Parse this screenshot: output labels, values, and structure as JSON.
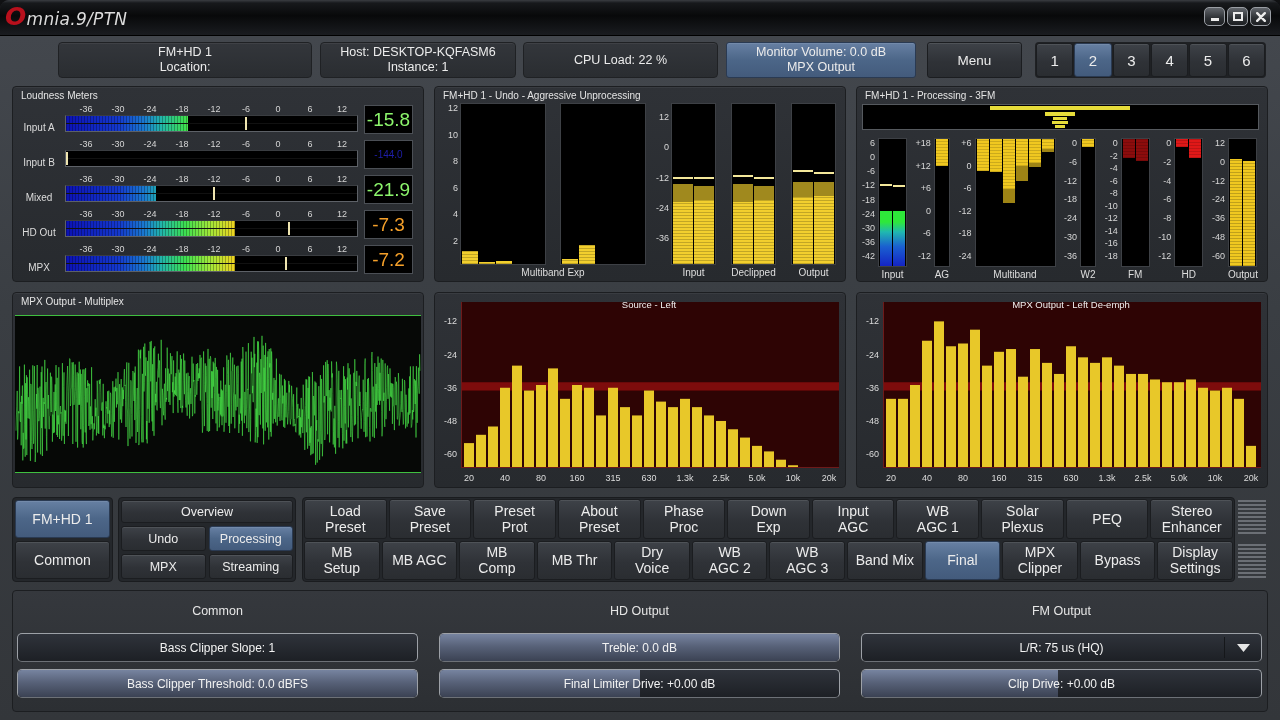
{
  "window": {
    "logo": "Omnia.9/PTN"
  },
  "header": {
    "info": [
      {
        "lines": [
          "FM+HD 1",
          "Location:"
        ]
      },
      {
        "lines": [
          "Host: DESKTOP-KQFASM6",
          "Instance: 1"
        ]
      },
      {
        "lines": [
          "CPU Load: 22 %"
        ]
      }
    ],
    "monitor": {
      "label": "Monitor Volume: 0.0 dB\nMPX Output",
      "active": true
    },
    "menu": "Menu",
    "presets": [
      {
        "label": "1",
        "selected": false
      },
      {
        "label": "2",
        "selected": true
      },
      {
        "label": "3",
        "selected": false
      },
      {
        "label": "4",
        "selected": false
      },
      {
        "label": "5",
        "selected": false
      },
      {
        "label": "6",
        "selected": false
      }
    ]
  },
  "loudness": {
    "title": "Loudness Meters",
    "meters": [
      {
        "label": "Input A",
        "kind": "input",
        "scale": [
          "-36",
          "-30",
          "-24",
          "-18",
          "-12",
          "-6",
          "0",
          "6",
          "12"
        ],
        "level": 0.42,
        "peak": {
          "level": 0.62
        },
        "reading": "-15.8",
        "dimmed": false
      },
      {
        "label": "Input B",
        "kind": "input",
        "scale": [
          "-36",
          "-30",
          "-24",
          "-18",
          "-12",
          "-6",
          "0",
          "6",
          "12"
        ],
        "level": 0,
        "peak": {
          "level": 0.005
        },
        "reading": "-144.0",
        "dimmed": true
      },
      {
        "label": "Mixed",
        "kind": "input",
        "scale": [
          "-36",
          "-30",
          "-24",
          "-18",
          "-12",
          "-6",
          "0",
          "6",
          "12"
        ],
        "level": 0.31,
        "peak": {
          "level": 0.51
        },
        "reading": "-21.9",
        "dimmed": false
      },
      {
        "label": "HD Out",
        "kind": "output",
        "scale": [
          "-36",
          "-30",
          "-24",
          "-18",
          "-12",
          "-6",
          "0",
          "6",
          "12"
        ],
        "level": 0.58,
        "peak": {
          "level": 0.765
        },
        "reading": "-7.3",
        "dimmed": false
      },
      {
        "label": "MPX",
        "kind": "output",
        "scale": [
          "-36",
          "-30",
          "-24",
          "-18",
          "-12",
          "-6",
          "0",
          "6",
          "12"
        ],
        "level": 0.58,
        "peak": {
          "level": 0.755
        },
        "reading": "-7.2",
        "dimmed": false
      }
    ]
  },
  "undo_panel": {
    "title": "FM+HD 1 - Undo - Aggressive Unprocessing",
    "multiband": {
      "label": "Multiband Exp",
      "scale": [
        "12",
        "10",
        "8",
        "6",
        "4",
        "2"
      ],
      "boxes": [
        {
          "bars": [
            {
              "level": 0.08
            },
            {
              "level": 0.01
            },
            {
              "level": 0.02
            }
          ]
        },
        {
          "bars": [
            {
              "level": 0.03
            },
            {
              "level": 0.12
            }
          ]
        }
      ]
    },
    "scale": [
      "12",
      "0",
      "-12",
      "-24",
      "-36"
    ],
    "meters": [
      {
        "label": "Input",
        "bars": [
          {
            "level": 0.39,
            "hold": {
              "level": 0.5
            },
            "peak": {
              "level": 0.54
            }
          },
          {
            "level": 0.4,
            "hold": {
              "level": 0.485
            },
            "peak": {
              "level": 0.536
            }
          }
        ]
      },
      {
        "label": "Declipped",
        "bars": [
          {
            "level": 0.39,
            "hold": {
              "level": 0.5
            },
            "peak": {
              "level": 0.55
            }
          },
          {
            "level": 0.4,
            "hold": {
              "level": 0.485
            },
            "peak": {
              "level": 0.54
            }
          }
        ]
      },
      {
        "label": "Output",
        "bars": [
          {
            "level": 0.417,
            "hold": {
              "level": 0.513
            },
            "peak": {
              "level": 0.583
            }
          },
          {
            "level": 0.423,
            "hold": {
              "level": 0.513
            },
            "peak": {
              "level": 0.567
            }
          }
        ]
      }
    ]
  },
  "processing_panel": {
    "title": "FM+HD 1 - Processing - 3FM",
    "meters": [
      {
        "label": "Input",
        "kind": "input",
        "color": "#2ee83a",
        "scale": [
          "6",
          "0",
          "-6",
          "-12",
          "-18",
          "-24",
          "-30",
          "-36",
          "-42"
        ],
        "bars": [
          {
            "level": 0.43,
            "peak": {
              "level": 0.64
            }
          },
          {
            "level": 0.43,
            "peak": {
              "level": 0.63
            }
          }
        ]
      },
      {
        "label": "AG",
        "kind": "gain",
        "color": "#f0c820",
        "scale": [
          "+18",
          "+12",
          "+6",
          "0",
          "-6",
          "-12"
        ],
        "bars": [
          {
            "level": 0.21
          }
        ]
      },
      {
        "label": "Multiband",
        "kind": "gain",
        "color": "#f0c820",
        "scale": [
          "+6",
          "0",
          "-6",
          "-12",
          "-18",
          "-24"
        ],
        "bars": [
          {
            "level": 0.25
          },
          {
            "level": 0.26
          },
          {
            "level": 0.39,
            "hold": {
              "level": 0.5
            }
          },
          {
            "level": 0.21,
            "hold": {
              "level": 0.33
            }
          },
          {
            "level": 0.19,
            "hold": {
              "level": 0.22
            }
          },
          {
            "level": 0.08,
            "hold": {
              "level": 0.1
            }
          }
        ]
      },
      {
        "label": "W2",
        "kind": "gain",
        "color": "#f0c820",
        "scale": [
          "0",
          "-6",
          "-12",
          "-18",
          "-24",
          "-30",
          "-36"
        ],
        "bars": [
          {
            "level": 0.06
          }
        ]
      },
      {
        "label": "FM",
        "kind": "gain",
        "color": "#8c0c0c",
        "scale": [
          "0",
          "-2",
          "-4",
          "-6",
          "-8",
          "-10",
          "-12",
          "-14",
          "-16",
          "-18"
        ],
        "bars": [
          {
            "level": 0.15
          },
          {
            "level": 0.17
          }
        ]
      },
      {
        "label": "HD",
        "kind": "gain",
        "color": "#e01818",
        "scale": [
          "0",
          "-2",
          "-4",
          "-6",
          "-8",
          "-10",
          "-12"
        ],
        "bars": [
          {
            "level": 0.065
          },
          {
            "level": 0.15
          }
        ]
      },
      {
        "label": "Output",
        "kind": "level",
        "color": "#f0c820",
        "scale": [
          "12",
          "0",
          "-12",
          "-24",
          "-36",
          "-48",
          "-60"
        ],
        "bars": [
          {
            "level": 0.84
          },
          {
            "level": 0.83
          }
        ]
      }
    ]
  },
  "scope": {
    "title": "MPX Output - Multiplex"
  },
  "spectra": [
    {
      "chart_data": {
        "type": "bar",
        "title": "Source - Left",
        "categories": [
          "20",
          null,
          null,
          "40",
          null,
          null,
          "80",
          null,
          null,
          "160",
          null,
          null,
          "315",
          null,
          null,
          "630",
          null,
          null,
          "1.3k",
          null,
          null,
          "2.5k",
          null,
          null,
          "5.0k",
          null,
          null,
          "10k",
          null,
          null,
          "20k"
        ],
        "values": [
          9,
          12,
          15,
          29,
          37,
          28,
          30,
          36,
          25,
          30,
          29,
          19,
          29,
          22,
          19,
          28,
          24,
          22,
          25,
          22,
          19,
          17,
          14,
          11,
          8,
          6,
          3,
          1,
          null,
          null,
          null
        ],
        "base": [
          -65,
          -65,
          -65,
          -65,
          -65,
          -65,
          -65,
          -65,
          -65,
          -65,
          -65,
          -65,
          -65,
          -65,
          -65,
          -65,
          -65,
          -65,
          -65,
          -65,
          -65,
          -65,
          -65,
          -65,
          -65,
          -65,
          -65,
          -65,
          null,
          null,
          null
        ],
        "color": "#e8c829",
        "ylim": [
          -65,
          -5
        ],
        "yticks": [
          -12,
          -24,
          -36,
          -48,
          -60
        ],
        "bands": [
          {
            "axis": "y",
            "from": -37,
            "to": -34,
            "color": "#7e0c0c"
          }
        ]
      }
    },
    {
      "chart_data": {
        "type": "bar",
        "title": "MPX Output - Left De-emph",
        "categories": [
          "20",
          null,
          null,
          "40",
          null,
          null,
          "80",
          null,
          null,
          "160",
          null,
          null,
          "315",
          null,
          null,
          "630",
          null,
          null,
          "1.3k",
          null,
          null,
          "2.5k",
          null,
          null,
          "5.0k",
          null,
          null,
          "10k",
          null,
          null,
          "20k"
        ],
        "values": [
          25,
          25,
          30,
          46,
          53,
          44,
          45,
          50,
          37,
          42,
          43,
          33,
          43,
          38,
          34,
          44,
          40,
          38,
          40,
          37,
          34,
          34,
          32,
          31,
          31,
          32,
          29,
          28,
          29,
          25,
          8
        ],
        "base": [
          -65,
          -65,
          -65,
          -65,
          -65,
          -65,
          -65,
          -65,
          -65,
          -65,
          -65,
          -65,
          -65,
          -65,
          -65,
          -65,
          -65,
          -65,
          -65,
          -65,
          -65,
          -65,
          -65,
          -65,
          -65,
          -65,
          -65,
          -65,
          -65,
          -65,
          -65
        ],
        "color": "#e8c829",
        "ylim": [
          -65,
          -5
        ],
        "yticks": [
          -12,
          -24,
          -36,
          -48,
          -60
        ],
        "bands": [
          {
            "axis": "y",
            "from": -37,
            "to": -34,
            "color": "#7e0c0c"
          }
        ]
      }
    }
  ],
  "nav": {
    "channels": [
      {
        "label": "FM+HD 1",
        "selected": true
      },
      {
        "label": "Common",
        "selected": false
      }
    ],
    "views": [
      {
        "label": "Overview",
        "selected": false
      },
      {
        "label": "Undo",
        "selected": false
      },
      {
        "label": "Processing",
        "selected": true
      },
      {
        "label": "MPX",
        "selected": false
      },
      {
        "label": "Streaming",
        "selected": false
      }
    ],
    "rows": [
      {
        "buttons": [
          {
            "label": "Load\nPreset",
            "selected": false
          },
          {
            "label": "Save\nPreset",
            "selected": false
          },
          {
            "label": "Preset\nProt",
            "selected": false
          },
          {
            "label": "About\nPreset",
            "selected": false
          },
          {
            "label": "Phase\nProc",
            "selected": false
          },
          {
            "label": "Down\nExp",
            "selected": false
          },
          {
            "label": "Input\nAGC",
            "selected": false
          },
          {
            "label": "WB\nAGC 1",
            "selected": false
          },
          {
            "label": "Solar\nPlexus",
            "selected": false
          },
          {
            "label": "PEQ",
            "selected": false
          },
          {
            "label": "Stereo\nEnhancer",
            "selected": false
          }
        ]
      },
      {
        "buttons": [
          {
            "label": "MB\nSetup",
            "selected": false
          },
          {
            "label": "MB AGC",
            "selected": false
          },
          {
            "label": "MB\nComp",
            "selected": false
          },
          {
            "label": "MB Thr",
            "selected": false
          },
          {
            "label": "Dry\nVoice",
            "selected": false
          },
          {
            "label": "WB\nAGC 2",
            "selected": false
          },
          {
            "label": "WB\nAGC 3",
            "selected": false
          },
          {
            "label": "Band Mix",
            "selected": false
          },
          {
            "label": "Final",
            "selected": true
          },
          {
            "label": "MPX\nClipper",
            "selected": false
          },
          {
            "label": "Bypass",
            "selected": false
          },
          {
            "label": "Display\nSettings",
            "selected": false
          }
        ]
      }
    ]
  },
  "bottom": {
    "columns": [
      {
        "title": "Common",
        "controls": [
          {
            "kind": "button",
            "label": "Bass Clipper Slope: 1"
          },
          {
            "kind": "slider",
            "label": "Bass Clipper Threshold: 0.0 dBFS",
            "level": 1
          }
        ]
      },
      {
        "title": "HD Output",
        "controls": [
          {
            "kind": "slider",
            "label": "Treble: 0.0 dB",
            "level": 1
          },
          {
            "kind": "slider",
            "label": "Final Limiter Drive: +0.00 dB",
            "level": 0.5
          }
        ]
      },
      {
        "title": "FM Output",
        "controls": [
          {
            "kind": "dropdown",
            "label": "L/R: 75 us (HQ)"
          },
          {
            "kind": "slider",
            "label": "Clip Drive: +0.00 dB",
            "level": 0.49
          }
        ]
      }
    ]
  }
}
